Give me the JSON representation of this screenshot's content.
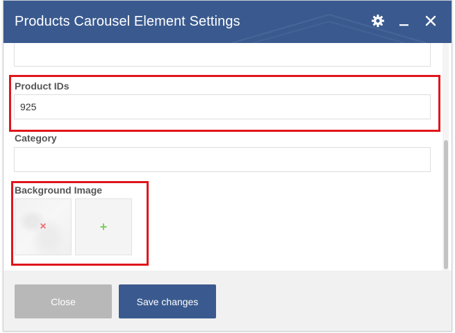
{
  "window": {
    "title": "Products Carousel Element Settings",
    "icons": [
      "gear-icon",
      "minimize-icon",
      "close-icon"
    ]
  },
  "fields": {
    "product_ids": {
      "label": "Product IDs",
      "value": "925"
    },
    "category": {
      "label": "Category",
      "value": ""
    },
    "background_image": {
      "label": "Background Image",
      "remove_glyph": "×",
      "add_glyph": "+"
    }
  },
  "footer": {
    "close_label": "Close",
    "save_label": "Save changes"
  },
  "colors": {
    "header": "#3a5a8f",
    "save_button": "#3a5a8f",
    "close_button": "#b8b8b8",
    "highlight_box": "#e0151b",
    "remove_icon": "#f26b73",
    "add_icon": "#7bcf5c"
  }
}
